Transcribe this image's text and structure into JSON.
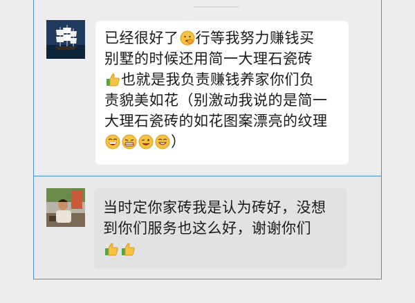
{
  "conversation": {
    "messages": [
      {
        "avatar": "sailing-ship-avatar",
        "bubble": "white",
        "lines": [
          "已经很好了",
          "行等我努力赚钱买",
          "别墅的时候还用简一大理石瓷砖",
          "也就是我负责赚钱养家你们负",
          "责貌美如花（别激动我说的是简一",
          "大理石瓷砖的如花图案漂亮的纹理",
          "）"
        ]
      },
      {
        "avatar": "person-photo-avatar",
        "bubble": "gray",
        "lines": [
          "当时定你家砖我是认为砖好，没想",
          "到你们服务也这么好，谢谢你们"
        ]
      }
    ]
  },
  "icons": {
    "emoji_face_hand": "emoji-embarrassed-icon",
    "emoji_thumbs": "thumbs-up-icon",
    "emoji_row": [
      "emoji-laugh-icon",
      "emoji-grin-icon",
      "emoji-wink-icon",
      "emoji-smile-icon"
    ]
  },
  "colors": {
    "frame_border": "#4a90d9",
    "background": "#ececec",
    "bubble_white": "#ffffff",
    "bubble_gray": "#e2e2e2",
    "emoji_yellow": "#f5c242"
  }
}
